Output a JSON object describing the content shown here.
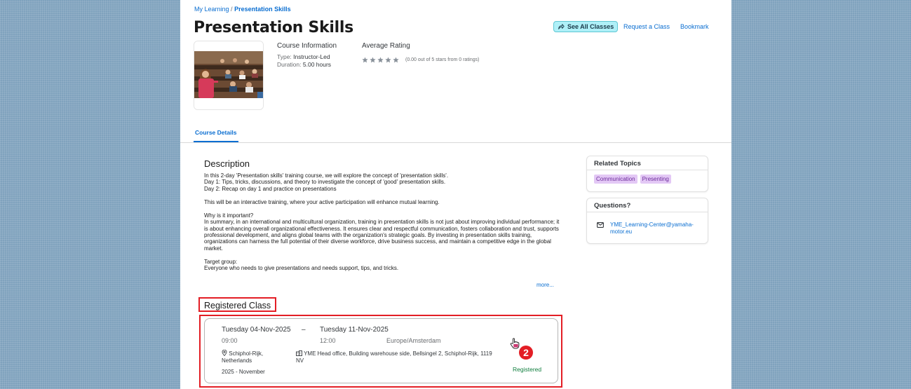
{
  "breadcrumb": {
    "root": "My Learning",
    "separator": "/",
    "current": "Presentation Skills"
  },
  "title": "Presentation Skills",
  "actions": {
    "see_all": "See All Classes",
    "request": "Request a Class",
    "bookmark": "Bookmark",
    "see_all_icon": "share-arrow-icon"
  },
  "course_info": {
    "title": "Course Information",
    "type_label": "Type:",
    "type_value": "Instructor-Led",
    "duration_label": "Duration:",
    "duration_value": "5.00 hours"
  },
  "rating": {
    "title": "Average Rating",
    "stars": 0,
    "max_stars": 5,
    "text": "(0.00 out of 5 stars from 0 ratings)"
  },
  "tabs": {
    "details": "Course Details"
  },
  "description": {
    "heading": "Description",
    "p1": "In this 2-day 'Presentation skills' training course, we will explore the concept of 'presentation skills'.\nDay 1: Tips, tricks, discussions, and theory to investigate the concept of 'good' presentation skills.\nDay 2: Recap on day 1 and practice on presentations",
    "p2": "This will be an interactive training, where your active participation will enhance mutual learning.",
    "p3": "Why is it important?\nIn summary, in an international and multicultural organization, training in presentation skills is not just about improving individual performance; it is about enhancing overall organizational effectiveness. It ensures clear and respectful communication, fosters collaboration and trust, supports professional development, and aligns global teams with the organization's strategic goals. By investing in presentation skills training, organizations can harness the full potential of their diverse workforce, drive business success, and maintain a competitive edge in the global market.",
    "p4": "Target group:\nEveryone who needs to give presentations and needs support, tips, and tricks.",
    "more": "more..."
  },
  "related": {
    "title": "Related Topics",
    "tags": [
      "Communication",
      "Presenting"
    ]
  },
  "questions": {
    "title": "Questions?",
    "email": "YME_Learning-Center@yamaha-motor.eu"
  },
  "registered": {
    "heading": "Registered Class",
    "start_date": "Tuesday 04-Nov-2025",
    "dash": "–",
    "end_date": "Tuesday 11-Nov-2025",
    "start_time": "09:00",
    "end_time": "12:00",
    "timezone": "Europe/Amsterdam",
    "location": "Schiphol-Rijk, Netherlands",
    "venue": "YME Head office, Building warehouse side, Bellsingel 2, Schiphol-Rijk, 1119 NV",
    "period": "2025 - November",
    "status": "Registered",
    "badge": "2"
  },
  "colors": {
    "accent": "#0a6ed1",
    "highlight_red": "#e31e25",
    "status_green": "#107e3e",
    "tag_bg": "#e3c8f5"
  }
}
